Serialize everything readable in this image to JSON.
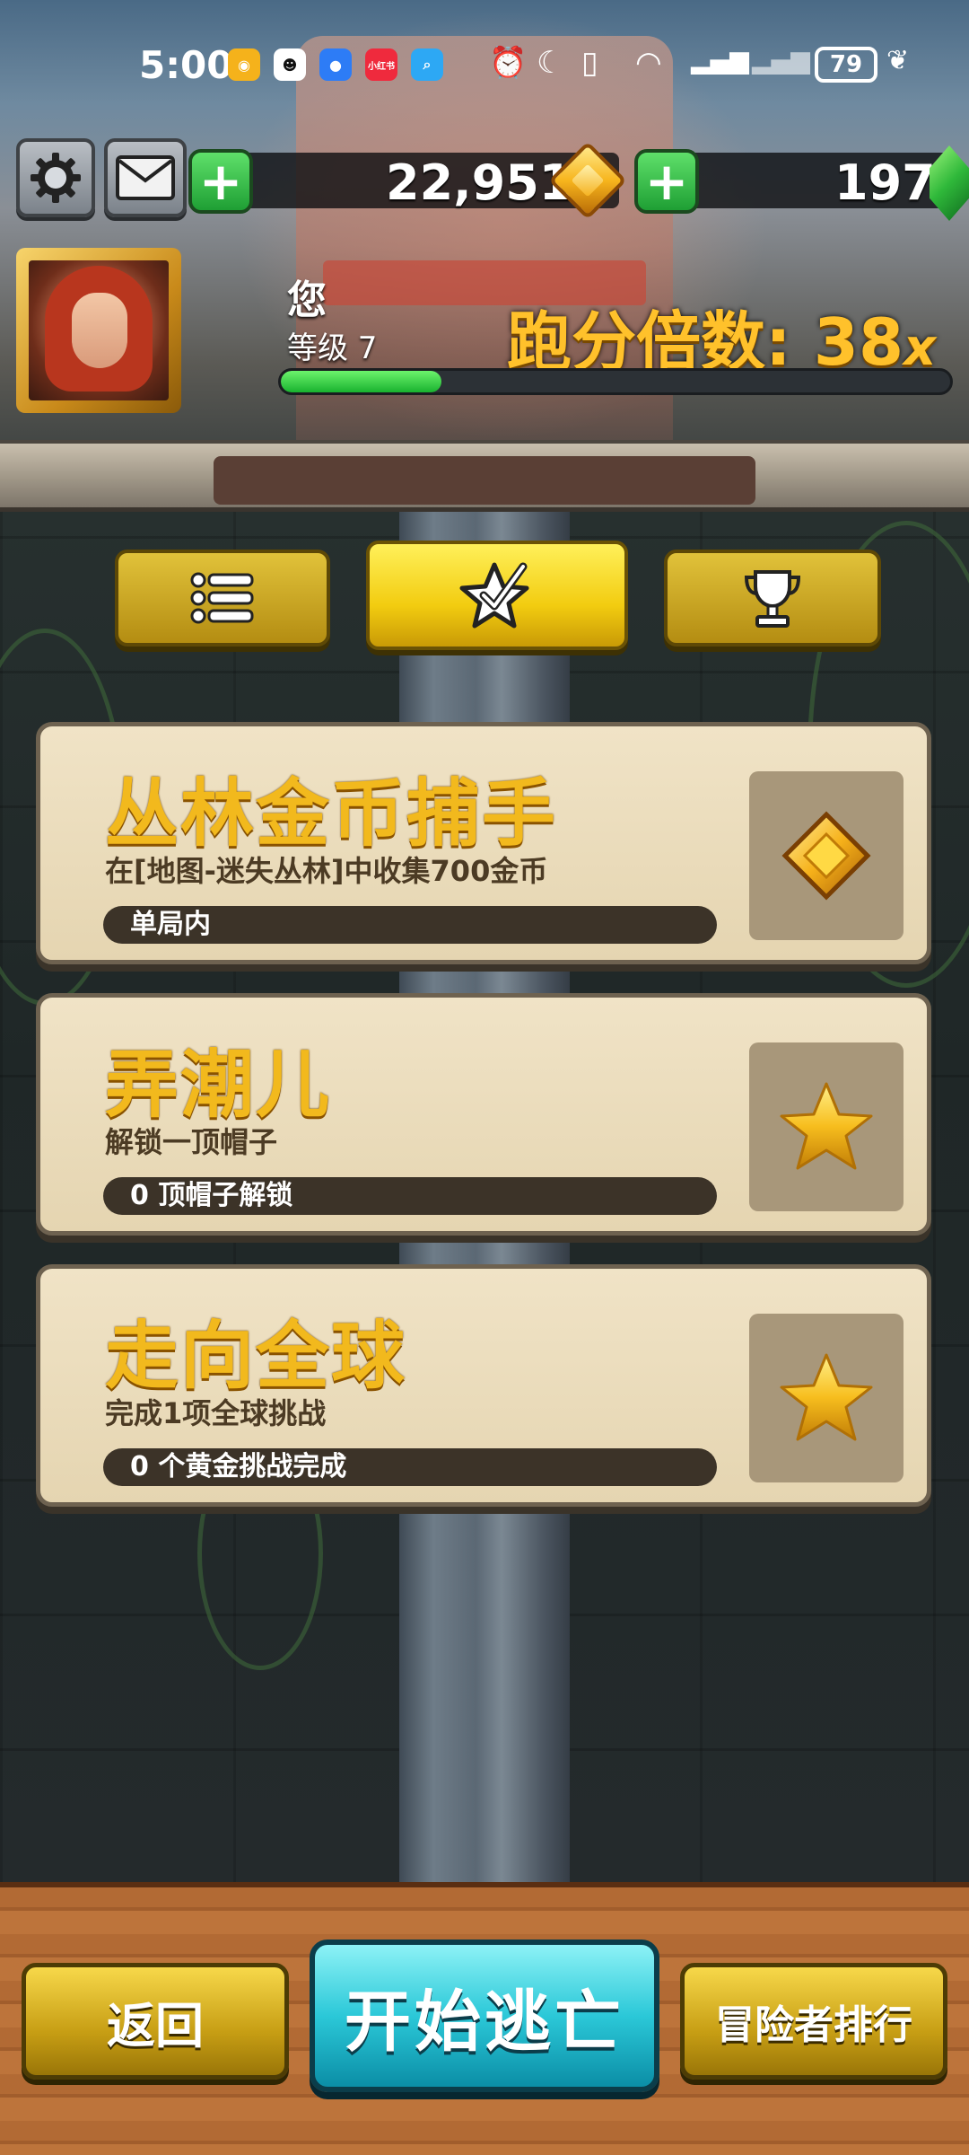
{
  "status_bar": {
    "time": "5:00",
    "apps": [
      {
        "icon": "weibo-icon",
        "color": "#f5b21b"
      },
      {
        "icon": "qq-icon",
        "color": "#ffffff"
      },
      {
        "icon": "browser-icon",
        "color": "#2d7cf6"
      },
      {
        "icon": "xiaohongshu-icon",
        "color": "#ef2a3d",
        "text": "小红书"
      },
      {
        "icon": "search-app-icon",
        "color": "#2da8f4"
      }
    ],
    "battery": "79"
  },
  "resources": {
    "coins": "22,951",
    "gems": "197"
  },
  "player": {
    "name": "您",
    "level": "等级 7",
    "multiplier_label": "跑分倍数: 38",
    "multiplier_suffix": "x",
    "xp_progress": 0.24
  },
  "tabs": [
    {
      "name": "list",
      "icon": "list-icon",
      "active": false
    },
    {
      "name": "missions",
      "icon": "star-check-icon",
      "active": true
    },
    {
      "name": "trophies",
      "icon": "trophy-icon",
      "active": false
    }
  ],
  "missions": [
    {
      "title": "丛林金币捕手",
      "desc": "在[地图-迷失丛林]中收集700金币",
      "progress": "单局内",
      "icon": "coin-icon"
    },
    {
      "title": "弄潮儿",
      "desc": "解锁一顶帽子",
      "progress": "0 顶帽子解锁",
      "icon": "star-icon"
    },
    {
      "title": "走向全球",
      "desc": "完成1项全球挑战",
      "progress": "0 个黄金挑战完成",
      "icon": "star-icon"
    }
  ],
  "bottom": {
    "back_label": "返回",
    "start_label": "开始逃亡",
    "leaderboard_label": "冒险者排行"
  },
  "colors": {
    "title_gold": "#f2b91d",
    "xp_green": "#19b22f",
    "start_cyan": "#2bc8d8"
  }
}
